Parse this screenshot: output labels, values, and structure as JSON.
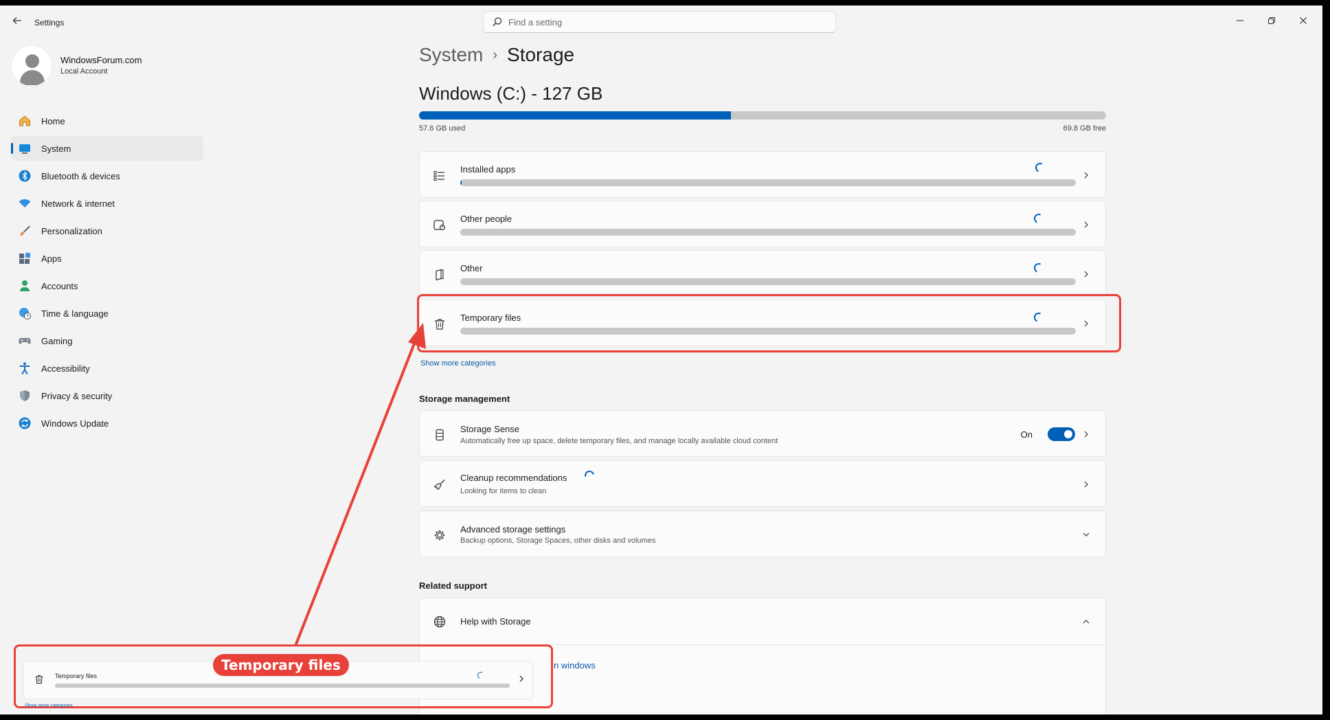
{
  "app": {
    "title": "Settings"
  },
  "search": {
    "placeholder": "Find a setting"
  },
  "profile": {
    "name": "WindowsForum.com",
    "account_type": "Local Account"
  },
  "nav": {
    "items": [
      {
        "label": "Home",
        "icon": "home-icon",
        "active": false
      },
      {
        "label": "System",
        "icon": "monitor-icon",
        "active": true
      },
      {
        "label": "Bluetooth & devices",
        "icon": "bluetooth-icon",
        "active": false
      },
      {
        "label": "Network & internet",
        "icon": "wifi-icon",
        "active": false
      },
      {
        "label": "Personalization",
        "icon": "brush-icon",
        "active": false
      },
      {
        "label": "Apps",
        "icon": "apps-icon",
        "active": false
      },
      {
        "label": "Accounts",
        "icon": "person-icon",
        "active": false
      },
      {
        "label": "Time & language",
        "icon": "globe-clock-icon",
        "active": false
      },
      {
        "label": "Gaming",
        "icon": "gamepad-icon",
        "active": false
      },
      {
        "label": "Accessibility",
        "icon": "accessibility-icon",
        "active": false
      },
      {
        "label": "Privacy & security",
        "icon": "shield-icon",
        "active": false
      },
      {
        "label": "Windows Update",
        "icon": "update-icon",
        "active": false
      }
    ]
  },
  "breadcrumb": {
    "parent": "System",
    "separator": "›",
    "current": "Storage"
  },
  "drive": {
    "title": "Windows (C:) - 127 GB",
    "used_label": "57.6 GB used",
    "free_label": "69.8 GB free",
    "used_fraction": 0.454
  },
  "categories": [
    {
      "title": "Installed apps",
      "icon": "list-icon",
      "fill": 0.002
    },
    {
      "title": "Other people",
      "icon": "people-icon",
      "fill": 0
    },
    {
      "title": "Other",
      "icon": "document-icon",
      "fill": 0
    },
    {
      "title": "Temporary files",
      "icon": "trash-icon",
      "fill": 0
    }
  ],
  "show_more": "Show more categories",
  "management": {
    "title": "Storage management",
    "storage_sense": {
      "title": "Storage Sense",
      "desc": "Automatically free up space, delete temporary files, and manage locally available cloud content",
      "state_label": "On"
    },
    "cleanup": {
      "title": "Cleanup recommendations",
      "desc": "Looking for items to clean"
    },
    "advanced": {
      "title": "Advanced storage settings",
      "desc": "Backup options, Storage Spaces, other disks and volumes"
    }
  },
  "related": {
    "title": "Related support",
    "help_title": "Help with Storage",
    "link_fragment": "n windows"
  },
  "annotation": {
    "label": "Temporary files",
    "mini_title": "Temporary files",
    "mini_more": "Show more categories",
    "color": "#e8413a"
  },
  "colors": {
    "accent": "#005fb8",
    "annotation": "#e8413a"
  }
}
